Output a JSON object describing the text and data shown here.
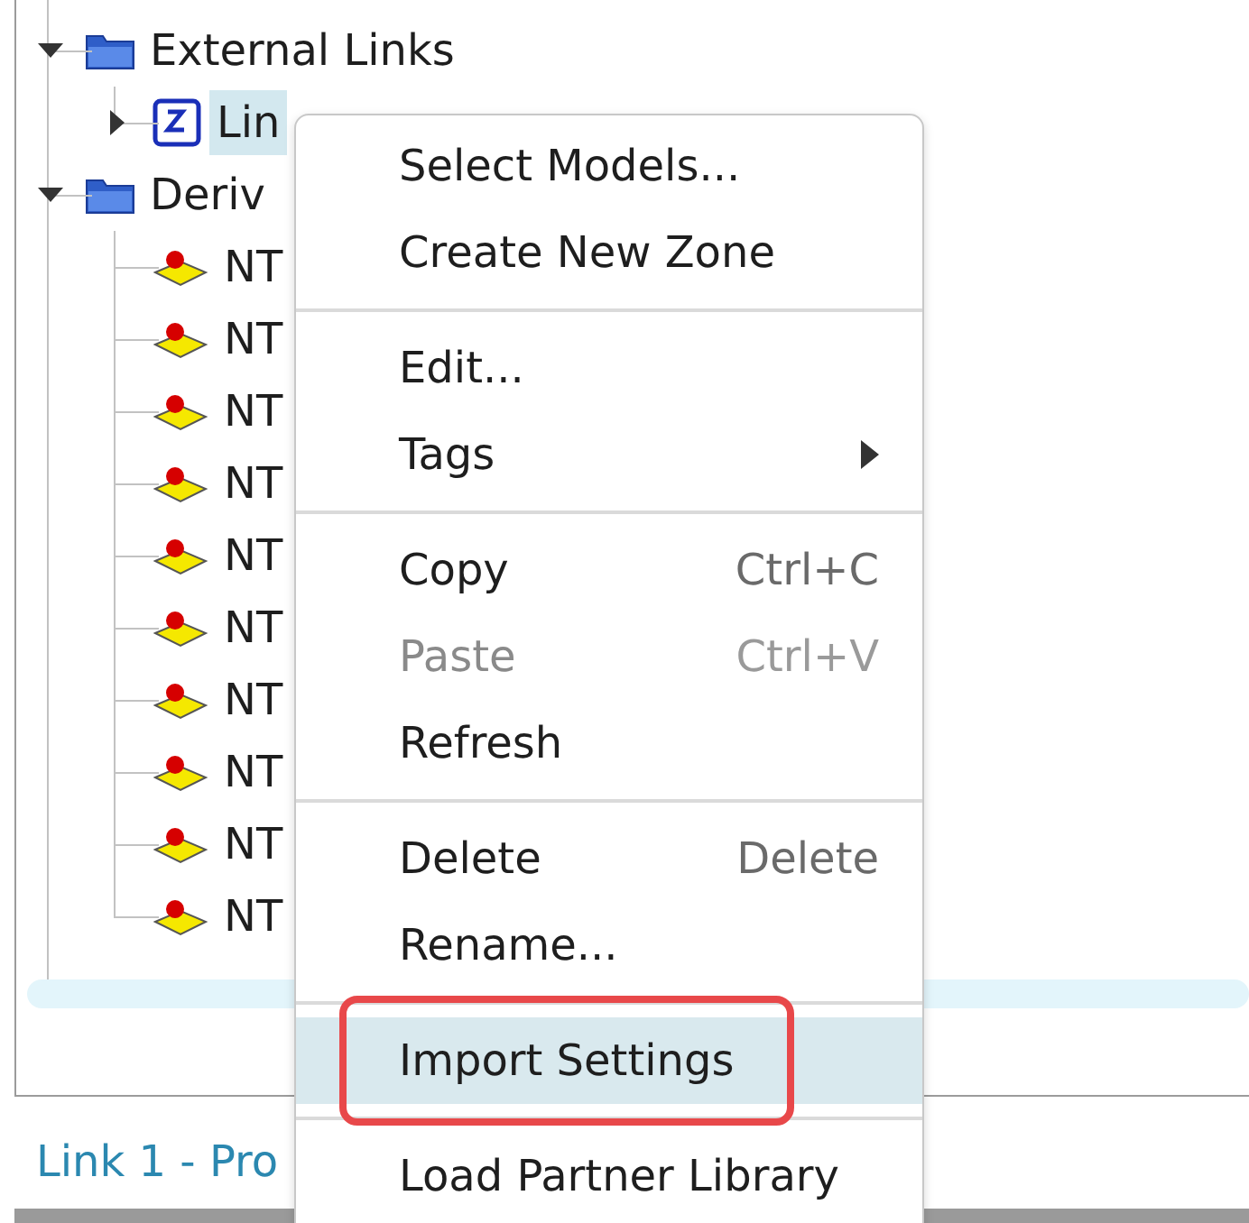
{
  "tree": [
    {
      "label": "External Links",
      "kind": "folder",
      "expanded": true,
      "selected": false,
      "children": [
        {
          "label": "Lin",
          "kind": "link",
          "expanded": false,
          "selected": true
        }
      ]
    },
    {
      "label": "Deriv",
      "kind": "folder",
      "expanded": true,
      "selected": false,
      "children": [
        {
          "label": "NT",
          "kind": "part",
          "selected": false
        },
        {
          "label": "NT",
          "kind": "part",
          "selected": false
        },
        {
          "label": "NT",
          "kind": "part",
          "selected": false
        },
        {
          "label": "NT",
          "kind": "part",
          "selected": false
        },
        {
          "label": "NT",
          "kind": "part",
          "selected": false
        },
        {
          "label": "NT",
          "kind": "part",
          "selected": false
        },
        {
          "label": "NT",
          "kind": "part",
          "selected": false
        },
        {
          "label": "NT",
          "kind": "part",
          "selected": false
        },
        {
          "label": "NT",
          "kind": "part",
          "selected": false
        },
        {
          "label": "NT",
          "kind": "part",
          "selected": false
        }
      ]
    }
  ],
  "properties_title": "Link 1 - Pro",
  "context_menu": [
    {
      "kind": "item",
      "label": "Select Models...",
      "disabled": false,
      "selected": false
    },
    {
      "kind": "item",
      "label": "Create New Zone",
      "disabled": false,
      "selected": false
    },
    {
      "kind": "separator"
    },
    {
      "kind": "item",
      "label": "Edit...",
      "disabled": false,
      "selected": false
    },
    {
      "kind": "item",
      "label": "Tags",
      "disabled": false,
      "selected": false,
      "submenu": true
    },
    {
      "kind": "separator"
    },
    {
      "kind": "item",
      "label": "Copy",
      "shortcut": "Ctrl+C",
      "disabled": false,
      "selected": false
    },
    {
      "kind": "item",
      "label": "Paste",
      "shortcut": "Ctrl+V",
      "disabled": true,
      "selected": false
    },
    {
      "kind": "item",
      "label": "Refresh",
      "disabled": false,
      "selected": false
    },
    {
      "kind": "separator"
    },
    {
      "kind": "item",
      "label": "Delete",
      "shortcut": "Delete",
      "disabled": false,
      "selected": false
    },
    {
      "kind": "item",
      "label": "Rename...",
      "disabled": false,
      "selected": false
    },
    {
      "kind": "separator"
    },
    {
      "kind": "item",
      "label": "Import Settings",
      "disabled": false,
      "selected": true,
      "annotated": true
    },
    {
      "kind": "separator"
    },
    {
      "kind": "item",
      "label": "Load Partner Library",
      "disabled": false,
      "selected": false
    }
  ]
}
